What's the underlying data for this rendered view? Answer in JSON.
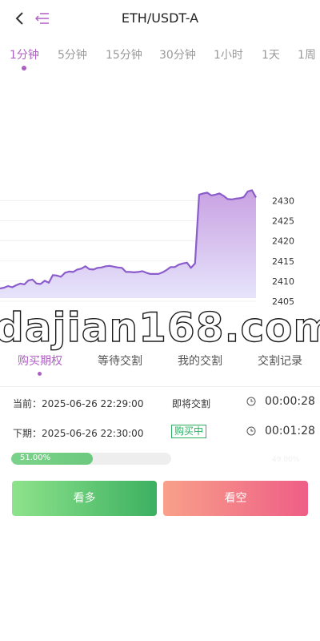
{
  "header": {
    "title": "ETH/USDT-A",
    "back_icon": "chevron-left-icon",
    "menu_icon": "menu-lines-icon"
  },
  "timeframes": [
    "1分钟",
    "5分钟",
    "15分钟",
    "30分钟",
    "1小时",
    "1天",
    "1周"
  ],
  "timeframe_selected": 0,
  "chart_data": {
    "type": "area",
    "y_ticks": [
      "2430",
      "2425",
      "2420",
      "2415",
      "2410",
      "2405"
    ],
    "ylim": [
      2403,
      2434
    ],
    "line_color": "#8b5ccc",
    "fill_top_color": "#c9a2e2",
    "fill_bottom_color": "#e4e2fb",
    "x": [
      0,
      1,
      2,
      3,
      4,
      5,
      6,
      7,
      8,
      9,
      10,
      11,
      12,
      13,
      14,
      15,
      16,
      17,
      18,
      19,
      20,
      21,
      22,
      23,
      24,
      25,
      26,
      27,
      28,
      29,
      30,
      31,
      32,
      33,
      34,
      35,
      36,
      37,
      38,
      39,
      40,
      41,
      42,
      43,
      44,
      45,
      46,
      47,
      48,
      49,
      50,
      51,
      52,
      53,
      54,
      55,
      56,
      57,
      58,
      59,
      60,
      61,
      62,
      63
    ],
    "values": [
      2408.2,
      2408.4,
      2408.8,
      2408.5,
      2409.0,
      2409.4,
      2409.2,
      2410.2,
      2410.4,
      2409.4,
      2409.3,
      2410.1,
      2409.6,
      2411.5,
      2411.4,
      2411.1,
      2412.1,
      2412.4,
      2412.3,
      2412.9,
      2413.1,
      2413.7,
      2413.0,
      2412.9,
      2413.3,
      2413.4,
      2413.7,
      2413.8,
      2413.6,
      2413.4,
      2413.3,
      2412.3,
      2412.3,
      2412.2,
      2412.3,
      2412.5,
      2412.1,
      2411.8,
      2411.8,
      2411.8,
      2412.2,
      2412.8,
      2413.5,
      2413.5,
      2414.1,
      2414.4,
      2414.6,
      2413.3,
      2414.4,
      2431.5,
      2431.8,
      2432.0,
      2431.3,
      2431.5,
      2431.8,
      2431.2,
      2430.4,
      2430.3,
      2430.5,
      2430.6,
      2430.9,
      2432.3,
      2432.6,
      2430.8
    ]
  },
  "watermark": "dajian168.com",
  "order_tabs": [
    "购买期权",
    "等待交割",
    "我的交割",
    "交割记录"
  ],
  "order_tab_selected": 0,
  "periods": {
    "current": {
      "label": "当前：2025-06-26 22:29:00",
      "status": "即将交割",
      "countdown": "00:00:28"
    },
    "next": {
      "label": "下期：2025-06-26 22:30:00",
      "status": "购买中",
      "countdown": "00:01:28"
    }
  },
  "progress": {
    "text": "51.00%",
    "value": 0.51,
    "ghost_text": "49.00%"
  },
  "buttons": {
    "up": "看多",
    "down": "看空"
  },
  "colors": {
    "accent": "#b05fc4",
    "up": "#3cb061",
    "down": "#ee5e86",
    "badge": "#2eae63"
  }
}
